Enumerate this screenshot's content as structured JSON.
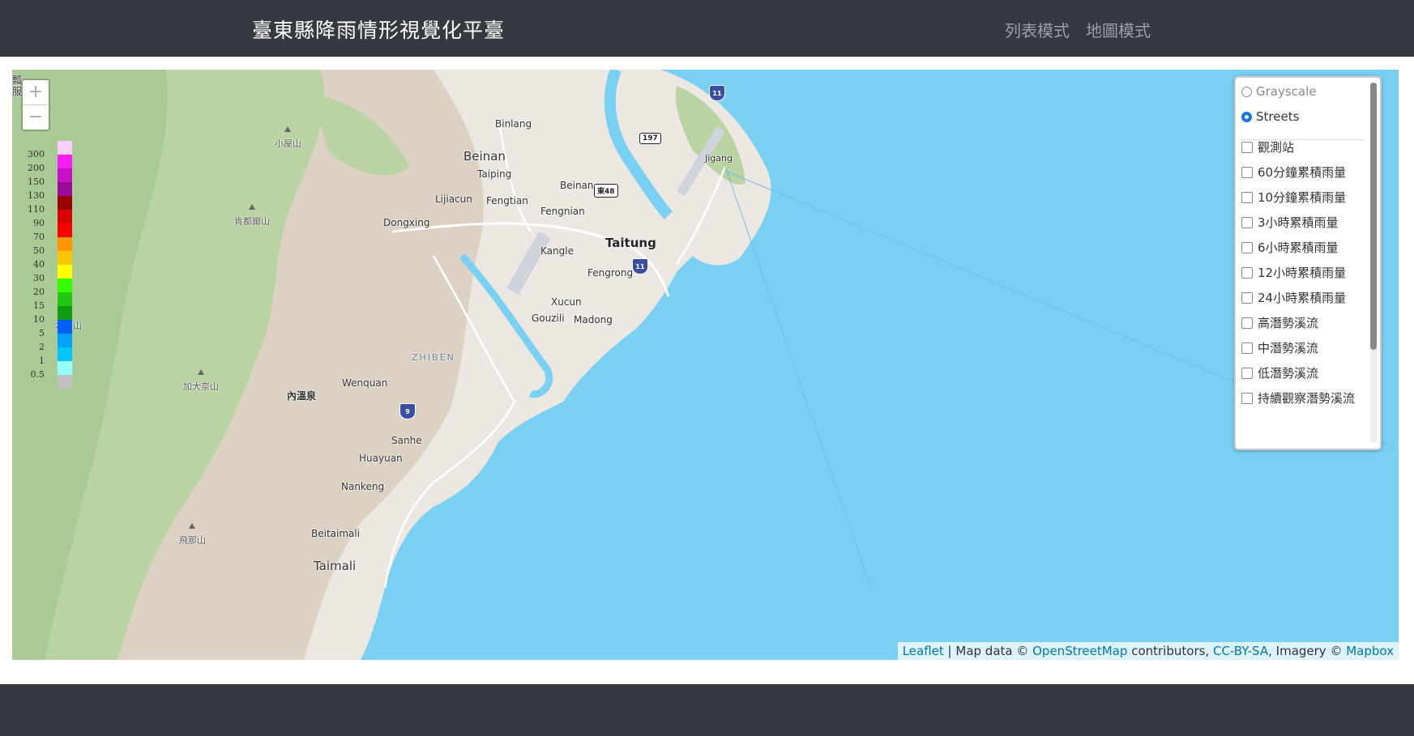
{
  "header": {
    "title": "臺東縣降雨情形視覺化平臺",
    "nav": [
      "列表模式",
      "地圖模式"
    ]
  },
  "map": {
    "zoom": {
      "in": "+",
      "out": "−"
    },
    "places": {
      "binlang": "Binlang",
      "beinan_city": "Beinan",
      "taiping": "Taiping",
      "beinan_small": "Beinan",
      "lijiacun": "Lijiacun",
      "fengtian": "Fengtian",
      "fengnian": "Fengnian",
      "dongxing": "Dongxing",
      "taitung": "Taitung",
      "kangle": "Kangle",
      "fengrong": "Fengrong",
      "xucun": "Xucun",
      "gouzili": "Gouzili",
      "madong": "Madong",
      "zhiben": "ZHIBEN",
      "wenquan": "Wenquan",
      "neiwenquan": "內溫泉",
      "sanhe": "Sanhe",
      "huayuan": "Huayuan",
      "nankeng": "Nankeng",
      "beitaimali": "Beitaimali",
      "taimali": "Taimali",
      "jigang": "Jigang"
    },
    "peaks": {
      "xiaowu": "小屋山",
      "kendu": "肯都爾山",
      "benzhu": "本主山",
      "jiada": "加大奈山",
      "feina": "飛那山"
    },
    "edge_text": "瓢\n服",
    "shields": {
      "h11_top": "11",
      "h11_mid": "11",
      "h9": "9"
    },
    "badges": {
      "r197": "197",
      "d48": "東48"
    }
  },
  "legend": {
    "labels": [
      "300",
      "200",
      "150",
      "130",
      "110",
      "90",
      "70",
      "50",
      "40",
      "30",
      "20",
      "15",
      "10",
      "5",
      "2",
      "1",
      "0.5"
    ],
    "colors": [
      "#fdcdfd",
      "#f91ff4",
      "#c910c8",
      "#9a0b9a",
      "#9a0000",
      "#d80000",
      "#ff0000",
      "#ff9800",
      "#ffc500",
      "#ffff00",
      "#33ff00",
      "#22c80c",
      "#109c0e",
      "#0062fe",
      "#01a2fe",
      "#00c6ff",
      "#97feff",
      "#c1c1c1"
    ]
  },
  "layers": {
    "base": [
      {
        "label": "Grayscale",
        "selected": false
      },
      {
        "label": "Streets",
        "selected": true
      }
    ],
    "overlays": [
      "觀測站",
      "60分鐘累積雨量",
      "10分鐘累積雨量",
      "3小時累積雨量",
      "6小時累積雨量",
      "12小時累積雨量",
      "24小時累積雨量",
      "高潛勢溪流",
      "中潛勢溪流",
      "低潛勢溪流",
      "持續觀察潛勢溪流"
    ]
  },
  "attribution": {
    "leaflet": "Leaflet",
    "sep": " | Map data © ",
    "osm": "OpenStreetMap",
    "contrib": " contributors, ",
    "license": "CC-BY-SA",
    "imagery": ", Imagery © ",
    "mapbox": "Mapbox"
  },
  "colors": {
    "sea": "#7ad0f2",
    "land": "#ece8e1",
    "forest": "#b9d3a3",
    "navbar": "#343a40"
  }
}
